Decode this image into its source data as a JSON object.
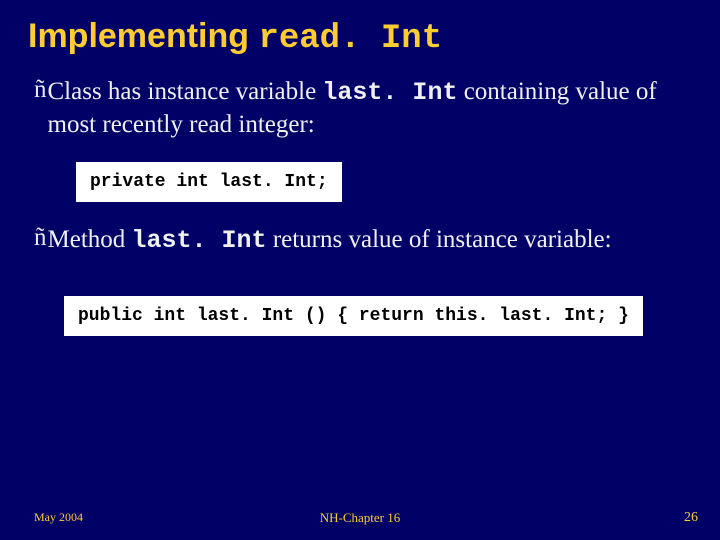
{
  "title": {
    "prefix": "Implementing ",
    "code": "read. Int"
  },
  "bullets": [
    {
      "pre": "Class has instance variable ",
      "code": "last. Int",
      "post": " containing value of most recently read integer:"
    },
    {
      "pre": "Method ",
      "code": "last. Int",
      "post": " returns value of instance variable:"
    }
  ],
  "code": [
    "private int last. Int;",
    "public int last. Int () { return this. last. Int; }"
  ],
  "footer": {
    "left": "May 2004",
    "center": "NH-Chapter 16",
    "right": "26"
  },
  "icons": {
    "bullet_arrow": "ñ"
  }
}
